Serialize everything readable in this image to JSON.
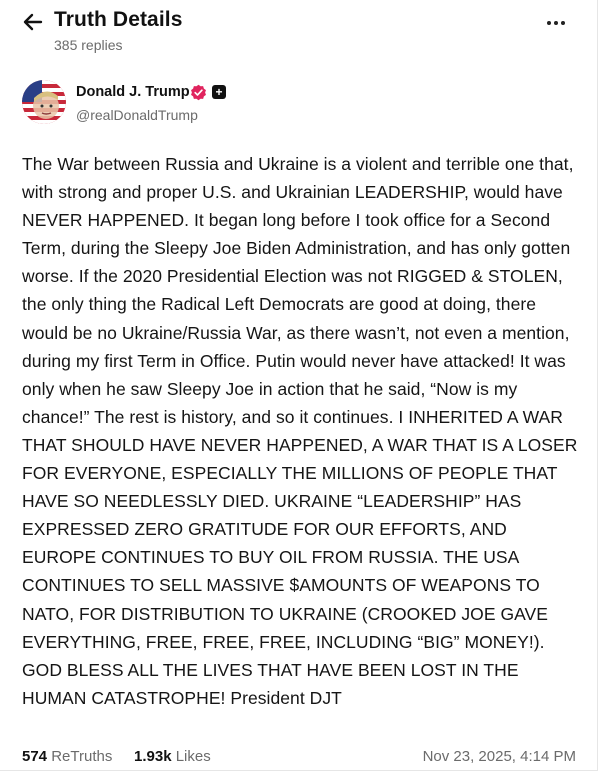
{
  "header": {
    "title": "Truth Details",
    "replies": "385 replies"
  },
  "author": {
    "display_name": "Donald J. Trump",
    "handle": "@realDonaldTrump"
  },
  "post": {
    "text": "The War between Russia and Ukraine is a violent and terrible one that, with strong and proper U.S. and Ukrainian LEADERSHIP, would have NEVER HAPPENED. It began long before I took office for a Second Term, during the Sleepy Joe Biden Administration, and has only gotten worse. If the 2020 Presidential Election was not RIGGED & STOLEN, the only thing the Radical Left Democrats are good at doing, there would be no Ukraine/Russia War, as there wasn’t, not even a mention, during my first Term in Office. Putin would never have attacked! It was only when he saw Sleepy Joe in action that he said, “Now is my chance!” The rest is history, and so it continues. I INHERITED A WAR THAT SHOULD HAVE NEVER HAPPENED, A WAR THAT IS A LOSER FOR EVERYONE, ESPECIALLY THE MILLIONS OF PEOPLE THAT HAVE SO NEEDLESSLY DIED. UKRAINE “LEADERSHIP” HAS EXPRESSED ZERO GRATITUDE FOR OUR EFFORTS, AND EUROPE CONTINUES TO BUY OIL FROM RUSSIA. THE USA CONTINUES TO SELL MASSIVE $AMOUNTS OF WEAPONS TO NATO, FOR DISTRIBUTION TO UKRAINE (CROOKED JOE GAVE EVERYTHING, FREE, FREE, FREE, INCLUDING “BIG” MONEY!). GOD BLESS ALL THE LIVES THAT HAVE BEEN LOST IN THE HUMAN CATASTROPHE! President DJT"
  },
  "stats": {
    "retruths_count": "574",
    "retruths_label": "ReTruths",
    "likes_count": "1.93k",
    "likes_label": "Likes",
    "timestamp": "Nov 23, 2025, 4:14 PM"
  },
  "icons": {
    "back": "arrow-left-icon",
    "more": "more-horizontal-icon",
    "verified": "verified-badge-icon",
    "plus": "plus-square-icon"
  },
  "colors": {
    "verified_badge": "#e0245e",
    "muted_text": "#6b6b6b"
  }
}
